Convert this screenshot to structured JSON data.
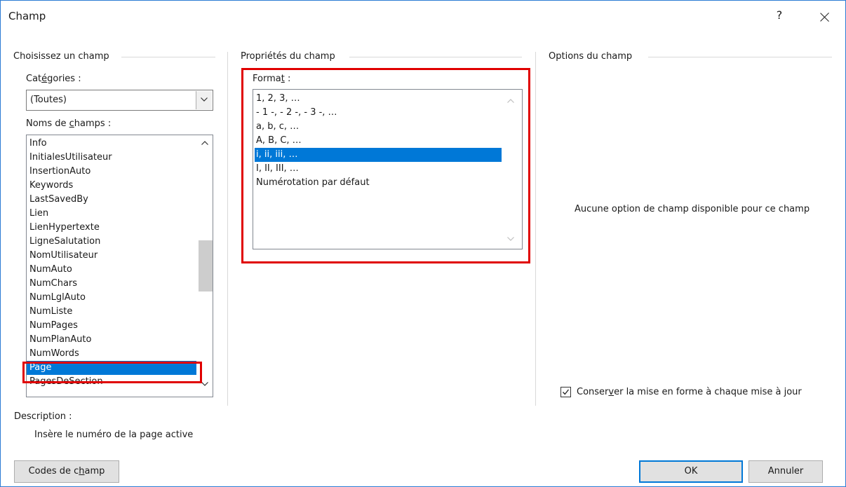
{
  "dialog": {
    "title": "Champ",
    "help_label": "?"
  },
  "left": {
    "section_title": "Choisissez un champ",
    "categories_label_pre": "Cat",
    "categories_label_u": "é",
    "categories_label_post": "gories :",
    "categories_value": "(Toutes)",
    "names_label_pre": "Noms de ",
    "names_label_u": "c",
    "names_label_post": "hamps :",
    "field_names": [
      "Info",
      "InitialesUtilisateur",
      "InsertionAuto",
      "Keywords",
      "LastSavedBy",
      "Lien",
      "LienHypertexte",
      "LigneSalutation",
      "NomUtilisateur",
      "NumAuto",
      "NumChars",
      "NumLglAuto",
      "NumListe",
      "NumPages",
      "NumPlanAuto",
      "NumWords",
      "Page",
      "PagesDeSection"
    ],
    "selected_field": "Page"
  },
  "middle": {
    "section_title": "Propriétés du champ",
    "format_label_pre": "Forma",
    "format_label_u": "t",
    "format_label_post": " :",
    "formats": [
      "1, 2, 3, …",
      "- 1 -, - 2 -, - 3 -, …",
      "a, b, c, …",
      "A, B, C, …",
      "i, ii, iii, …",
      "I, II, III, …",
      "Numérotation par défaut"
    ],
    "selected_format": "i, ii, iii, …"
  },
  "right": {
    "section_title": "Options du champ",
    "no_options_text": "Aucune option de champ disponible pour ce champ",
    "preserve_pre": "Conser",
    "preserve_u": "v",
    "preserve_post": "er la mise en forme à chaque mise à jour",
    "preserve_checked": true
  },
  "description": {
    "label": "Description :",
    "text": "Insère le numéro de la page active"
  },
  "buttons": {
    "field_codes_pre": "Codes de c",
    "field_codes_u": "h",
    "field_codes_post": "amp",
    "ok": "OK",
    "cancel": "Annuler"
  },
  "colors": {
    "selection": "#0078d7",
    "highlight_box": "#e00000"
  }
}
